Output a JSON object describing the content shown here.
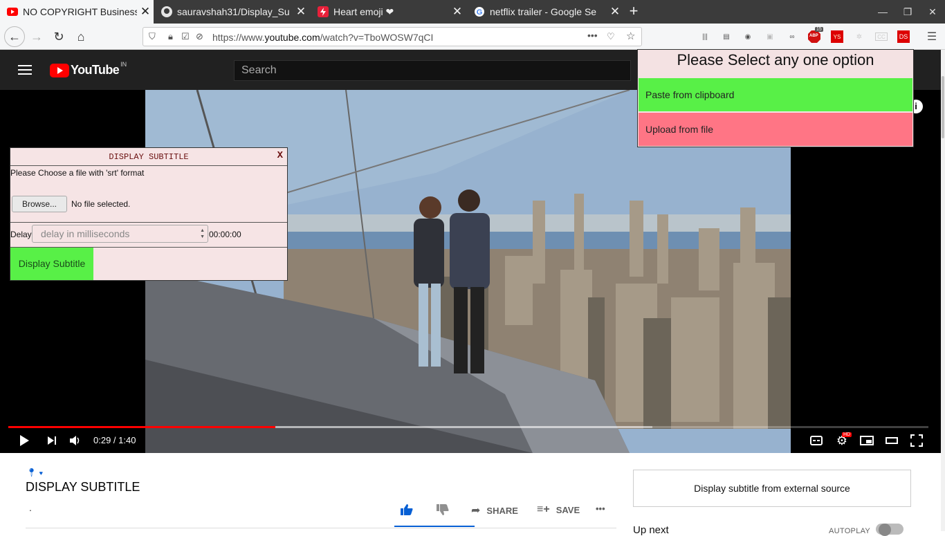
{
  "browser": {
    "tabs": [
      {
        "title": "NO COPYRIGHT Business",
        "favicon": "youtube-icon",
        "active": true
      },
      {
        "title": "sauravshah31/Display_Su",
        "favicon": "github-icon",
        "active": false
      },
      {
        "title": "Heart emoji ❤",
        "favicon": "bolt-icon",
        "active": false
      },
      {
        "title": "netflix trailer - Google Se",
        "favicon": "google-icon",
        "active": false
      }
    ],
    "new_tab_label": "+",
    "url_host": "youtube.com",
    "url_prefix": "https://www.",
    "url_path": "/watch?v=TboWOSW7qCI",
    "page_actions_label": "•••",
    "extension_badges": {
      "abp": "ABP",
      "abp_count": "15",
      "ys": "YS",
      "cc": "CC",
      "ds": "DS"
    }
  },
  "youtube": {
    "logo_text": "YouTube",
    "country_code": "IN",
    "search_placeholder": "Search"
  },
  "player": {
    "current_time": "0:29",
    "duration": "1:40",
    "time_display": "0:29 / 1:40",
    "progress_fraction": 0.29,
    "buffered_fraction": 0.7,
    "hd_badge": "HD"
  },
  "subtitle_panel": {
    "title": "DISPLAY SUBTITLE",
    "close_label": "X",
    "instruction": "Please Choose a file with 'srt' format",
    "browse_label": "Browse...",
    "file_status": "No file selected.",
    "delay_label": "Delay",
    "delay_placeholder": "delay in milliseconds",
    "delay_clock": "00:00:00",
    "display_button": "Display Subtitle"
  },
  "popup": {
    "title": "Please Select any one option",
    "option_paste": "Paste from clipboard",
    "option_upload": "Upload from file"
  },
  "video_info": {
    "title": "DISPLAY SUBTITLE",
    "description_dot": ".",
    "share_label": "SHARE",
    "save_label": "SAVE",
    "more_label": "•••"
  },
  "sidebar": {
    "external_button": "Display subtitle from external source",
    "up_next": "Up next",
    "autoplay": "AUTOPLAY"
  },
  "colors": {
    "youtube_red": "#ff0000",
    "panel_bg": "#f6e4e5",
    "green_option": "#58f047",
    "red_option": "#ff7585",
    "like_blue": "#065fd4"
  }
}
